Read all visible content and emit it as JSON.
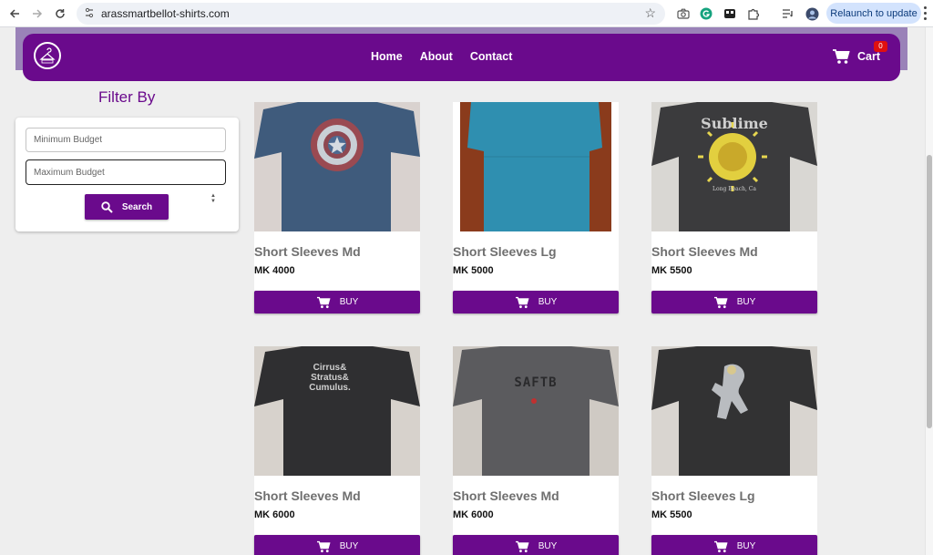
{
  "browser": {
    "url": "arassmartbellot-shirts.com",
    "relaunch_label": "Relaunch to update"
  },
  "navbar": {
    "links": [
      "Home",
      "About",
      "Contact"
    ],
    "cart_label": "Cart",
    "cart_count": "0"
  },
  "filter": {
    "title": "Filter By",
    "min_placeholder": "Minimum Budget",
    "max_placeholder": "Maximum Budget",
    "search_label": "Search"
  },
  "products": [
    {
      "title": "Short Sleeves Md",
      "price": "MK 4000",
      "buy_label": "BUY"
    },
    {
      "title": "Short Sleeves Lg",
      "price": "MK 5000",
      "buy_label": "BUY"
    },
    {
      "title": "Short Sleeves Md",
      "price": "MK 5500",
      "buy_label": "BUY",
      "print_text": "Sublime",
      "print_sub": "Long Beach, Ca"
    },
    {
      "title": "Short Sleeves Md",
      "price": "MK 6000",
      "buy_label": "BUY",
      "print_text": "Cirrus& Stratus& Cumulus."
    },
    {
      "title": "Short Sleeves Md",
      "price": "MK 6000",
      "buy_label": "BUY",
      "print_text": "SAFTB"
    },
    {
      "title": "Short Sleeves Lg",
      "price": "MK 5500",
      "buy_label": "BUY"
    }
  ],
  "colors": {
    "brand": "#6a0a8c",
    "badge": "#e01010"
  }
}
